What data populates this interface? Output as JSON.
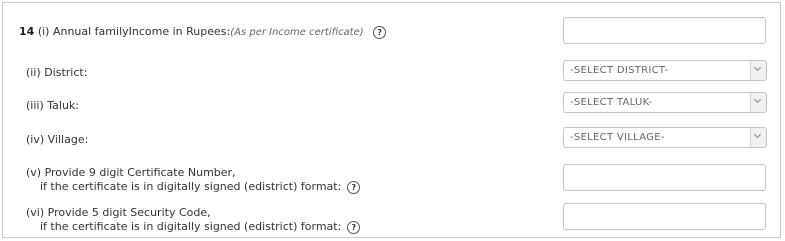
{
  "q14": {
    "number": "14",
    "label": "(i) Annual familyIncome in Rupees:",
    "hint": "(As per Income certificate)",
    "help_glyph": "?",
    "value": ""
  },
  "district": {
    "label": "(ii) District:",
    "selected": "-SELECT DISTRICT-"
  },
  "taluk": {
    "label": "(iii) Taluk:",
    "selected": "-SELECT TALUK-"
  },
  "village": {
    "label": "(iv) Village:",
    "selected": "-SELECT VILLAGE-"
  },
  "certificate_number": {
    "label_line1": "(v) Provide 9 digit Certificate Number,",
    "label_line2": "if the certificate is in digitally signed (edistrict) format:",
    "help_glyph": "?",
    "value": ""
  },
  "security_code": {
    "label_line1": "(vi) Provide 5 digit Security Code,",
    "label_line2": "if the certificate is in digitally signed (edistrict) format:",
    "help_glyph": "?",
    "value": ""
  }
}
